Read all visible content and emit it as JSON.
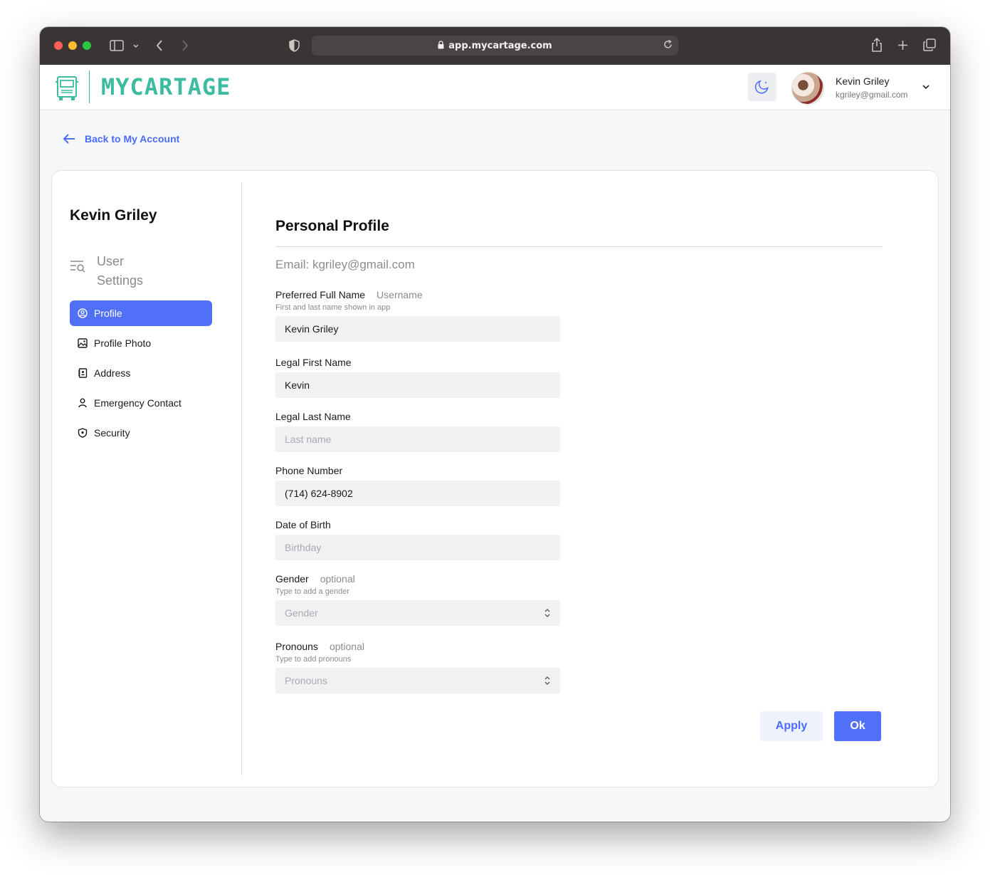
{
  "browser": {
    "url": "app.mycartage.com",
    "icons": [
      "sidebar-toggle-icon",
      "chevron-down-icon",
      "back-icon",
      "forward-icon",
      "shield-icon",
      "lock-icon",
      "reload-icon",
      "share-icon",
      "new-tab-icon",
      "tabs-overview-icon"
    ]
  },
  "header": {
    "brand": "MYCARTAGE",
    "brand_color": "#3dbba0",
    "user": {
      "name": "Kevin Griley",
      "email": "kgriley@gmail.com"
    }
  },
  "back_link": {
    "label": "Back to My Account"
  },
  "sidebar": {
    "title": "Kevin Griley",
    "section": {
      "line1": "User",
      "line2": "Settings"
    },
    "items": [
      {
        "label": "Profile",
        "icon": "user-circle-icon",
        "active": true
      },
      {
        "label": "Profile Photo",
        "icon": "image-icon",
        "active": false
      },
      {
        "label": "Address",
        "icon": "address-book-icon",
        "active": false
      },
      {
        "label": "Emergency Contact",
        "icon": "person-icon",
        "active": false
      },
      {
        "label": "Security",
        "icon": "shield-icon",
        "active": false
      }
    ]
  },
  "main": {
    "title": "Personal Profile",
    "email_line": "Email: kgriley@gmail.com",
    "fields": {
      "preferred_name": {
        "label": "Preferred Full Name",
        "aside": "Username",
        "help": "First and last name shown in app",
        "value": "Kevin Griley",
        "placeholder": ""
      },
      "first_name": {
        "label": "Legal First Name",
        "value": "Kevin",
        "placeholder": ""
      },
      "last_name": {
        "label": "Legal Last Name",
        "value": "",
        "placeholder": "Last name"
      },
      "phone": {
        "label": "Phone Number",
        "value": "(714) 624-8902",
        "placeholder": ""
      },
      "dob": {
        "label": "Date of Birth",
        "value": "",
        "placeholder": "Birthday"
      },
      "gender": {
        "label": "Gender",
        "aside": "optional",
        "help": "Type to add a gender",
        "placeholder": "Gender"
      },
      "pronouns": {
        "label": "Pronouns",
        "aside": "optional",
        "help": "Type to add pronouns",
        "placeholder": "Pronouns"
      }
    },
    "buttons": {
      "apply": "Apply",
      "ok": "Ok"
    }
  },
  "colors": {
    "accent": "#4f70f7",
    "accent_text": "#4a6cf7",
    "input_bg": "#f0f1f3"
  }
}
